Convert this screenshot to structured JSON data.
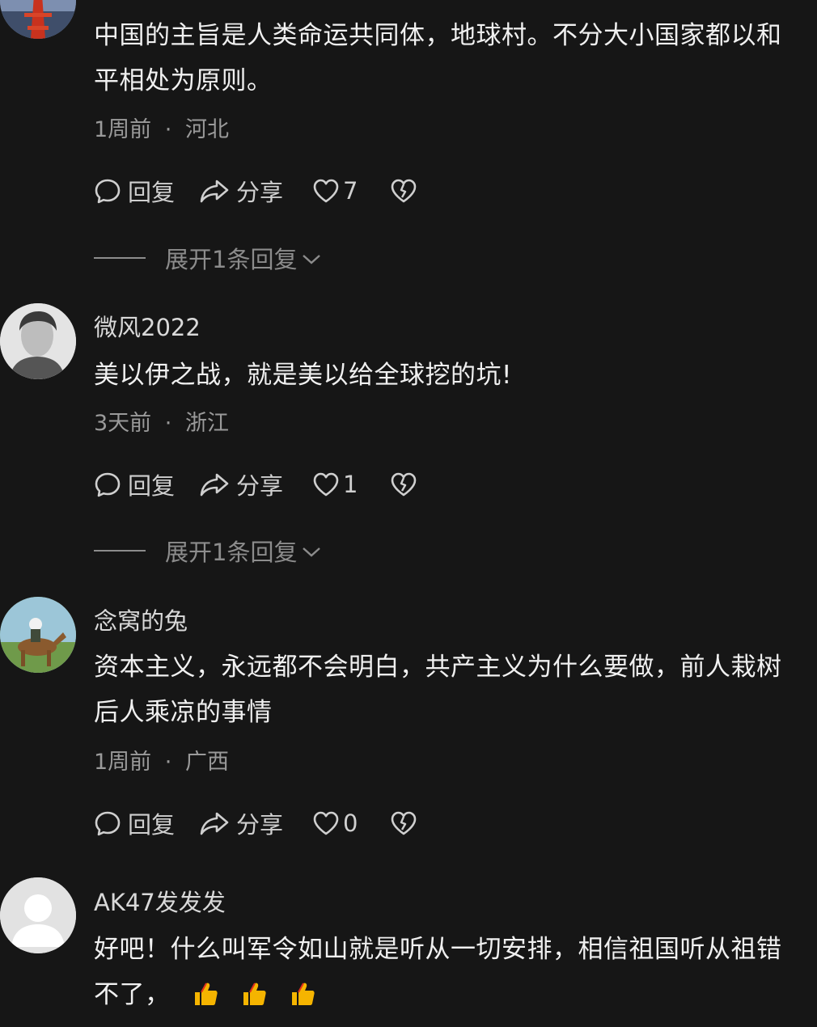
{
  "comments": [
    {
      "username": "",
      "text": "中国的主旨是人类命运共同体，地球村。不分大小国家都以和平相处为原则。",
      "time": "1周前",
      "location": "河北",
      "reply_label": "回复",
      "share_label": "分享",
      "likes": "7",
      "expand_label": "展开1条回复"
    },
    {
      "username": "微风2022",
      "text": "美以伊之战，就是美以给全球挖的坑!",
      "time": "3天前",
      "location": "浙江",
      "reply_label": "回复",
      "share_label": "分享",
      "likes": "1",
      "expand_label": "展开1条回复"
    },
    {
      "username": "念窝的兔",
      "text": "资本主义，永远都不会明白，共产主义为什么要做，前人栽树后人乘凉的事情",
      "time": "1周前",
      "location": "广西",
      "reply_label": "回复",
      "share_label": "分享",
      "likes": "0"
    },
    {
      "username": "AK47发发发",
      "text": "好吧！什么叫军令如山就是听从一切安排，相信祖国听从祖错不了，",
      "emoji": "thumbs-up-icon ×3"
    }
  ],
  "meta_separator": "·",
  "icons": [
    "comment-icon",
    "share-icon",
    "heart-icon",
    "broken-heart-icon",
    "chevron-down-icon",
    "thumbs-up-icon"
  ],
  "colors": {
    "background": "#161616",
    "text": "#f0f0f0",
    "secondary": "#9a9a9a",
    "thumbs_up": "#f5b400"
  }
}
